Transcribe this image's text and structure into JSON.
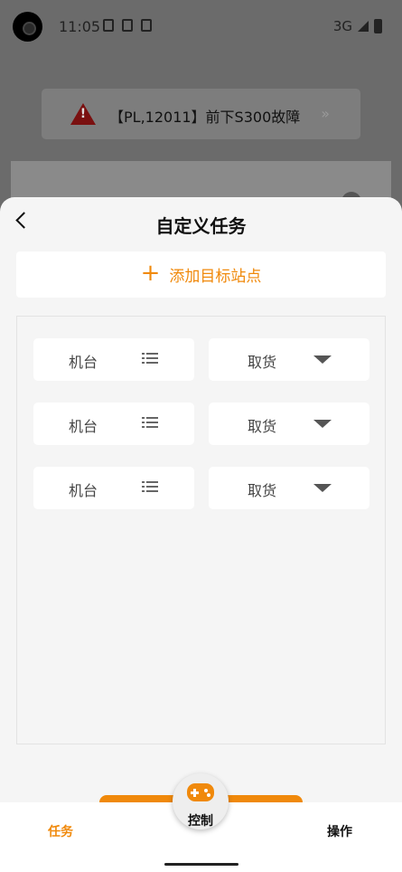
{
  "status_bar": {
    "time": "11:05",
    "network": "3G"
  },
  "alert": {
    "text": "【PL,12011】前下S300故障",
    "chevron": "»",
    "icon": "warning-icon"
  },
  "sheet": {
    "title": "自定义任务",
    "add_button_label": "添加目标站点",
    "rows": [
      {
        "station": "机台",
        "action": "取货"
      },
      {
        "station": "机台",
        "action": "取货"
      },
      {
        "station": "机台",
        "action": "取货"
      }
    ]
  },
  "tabbar": {
    "left_label": "任务",
    "center_label": "控制",
    "right_label": "操作"
  },
  "colors": {
    "accent": "#f0890b",
    "sheet_bg": "#f5f5f5",
    "alert_icon": "#7a1010"
  }
}
